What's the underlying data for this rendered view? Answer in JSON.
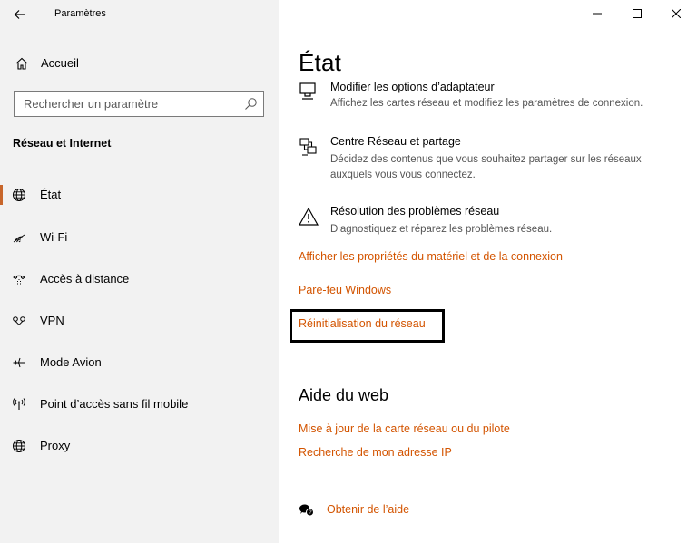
{
  "window": {
    "app_title": "Paramètres",
    "controls": {
      "minimize": "–",
      "maximize": "☐",
      "close": "✕"
    }
  },
  "sidebar": {
    "home_label": "Accueil",
    "search_placeholder": "Rechercher un paramètre",
    "section_title": "Réseau et Internet",
    "items": [
      {
        "label": "État",
        "icon": "globe-icon",
        "selected": true
      },
      {
        "label": "Wi-Fi",
        "icon": "wifi-icon",
        "selected": false
      },
      {
        "label": "Accès à distance",
        "icon": "dialup-icon",
        "selected": false
      },
      {
        "label": "VPN",
        "icon": "vpn-icon",
        "selected": false
      },
      {
        "label": "Mode Avion",
        "icon": "airplane-icon",
        "selected": false
      },
      {
        "label": "Point d’accès sans fil mobile",
        "icon": "hotspot-icon",
        "selected": false
      },
      {
        "label": "Proxy",
        "icon": "globe-icon",
        "selected": false
      }
    ],
    "accent_color": "#c8662b"
  },
  "main": {
    "title": "État",
    "options": [
      {
        "title": "Modifier les options d’adaptateur",
        "desc": "Affichez les cartes réseau et modifiez les paramètres de connexion.",
        "icon": "monitor-icon"
      },
      {
        "title": "Centre Réseau et partage",
        "desc": "Décidez des contenus que vous souhaitez partager sur les réseaux auxquels vous vous connectez.",
        "icon": "network-share-icon"
      },
      {
        "title": "Résolution des problèmes réseau",
        "desc": "Diagnostiquez et réparez les problèmes réseau.",
        "icon": "warning-icon"
      }
    ],
    "links": [
      "Afficher les propriétés du matériel et de la connexion",
      "Pare-feu Windows",
      "Réinitialisation du réseau"
    ],
    "web_help": {
      "title": "Aide du web",
      "links": [
        "Mise à jour de la carte réseau ou du pilote",
        "Recherche de mon adresse IP"
      ]
    },
    "get_help": "Obtenir de l’aide",
    "link_color": "#d35400"
  }
}
